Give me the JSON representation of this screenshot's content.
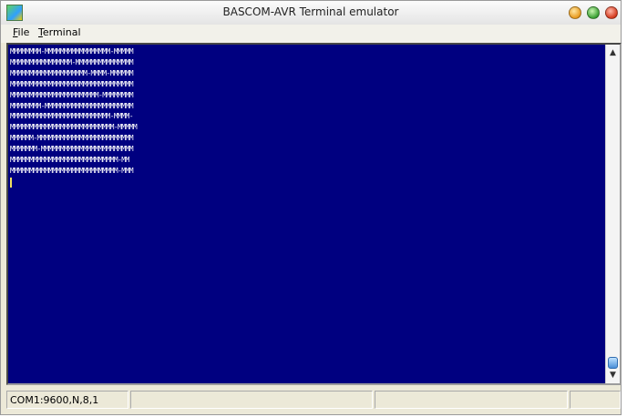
{
  "window": {
    "title": "BASCOM-AVR Terminal emulator",
    "icon_text": "Bas com AVR",
    "icon": "bascom-app-icon"
  },
  "menu": {
    "items": [
      {
        "label": "File",
        "accel": "F",
        "rest": "ile"
      },
      {
        "label": "Terminal",
        "accel": "T",
        "rest": "erminal"
      }
    ]
  },
  "terminal": {
    "background": "#000080",
    "text_color": "#ffffff",
    "lines": [
      "MMMMMMMM-MMMMMMMMMMMMMMMMM-MMMMM",
      "MMMMMMMMMMMMMMMM-MMMMMMMMMMMMMMM",
      "MMMMMMMMMMMMMMMMMMMM-MMMM-MMMMMM",
      "MMMMMMMMMMMMMMMMMMMMMMMMMMMMMMMM",
      "MMMMMMMMMMMMMMMMMMMMMMM-MMMMMMMM",
      "MMMMMMMM-MMMMMMMMMMMMMMMMMMMMMMM",
      "MMMMMMMMMMMMMMMMMMMMMMMMMM-MMMM-",
      "MMMMMMMMMMMMMMMMMMMMMMMMMMM-MMMMM",
      "MMMMMM-MMMMMMMMMMMMMMMMMMMMMMMMM",
      "MMMMMMM-MMMMMMMMMMMMMMMMMMMMMMMM",
      "MMMMMMMMMMMMMMMMMMMMMMMMMMMM-MM",
      "MMMMMMMMMMMMMMMMMMMMMMMMMMMM-MMM"
    ]
  },
  "scrollbar": {
    "up_glyph": "▲",
    "down_glyph": "▼",
    "position": 1.0
  },
  "status": {
    "port": "COM1:9600,N,8,1",
    "panel2": "",
    "panel3": "",
    "panel4": ""
  }
}
